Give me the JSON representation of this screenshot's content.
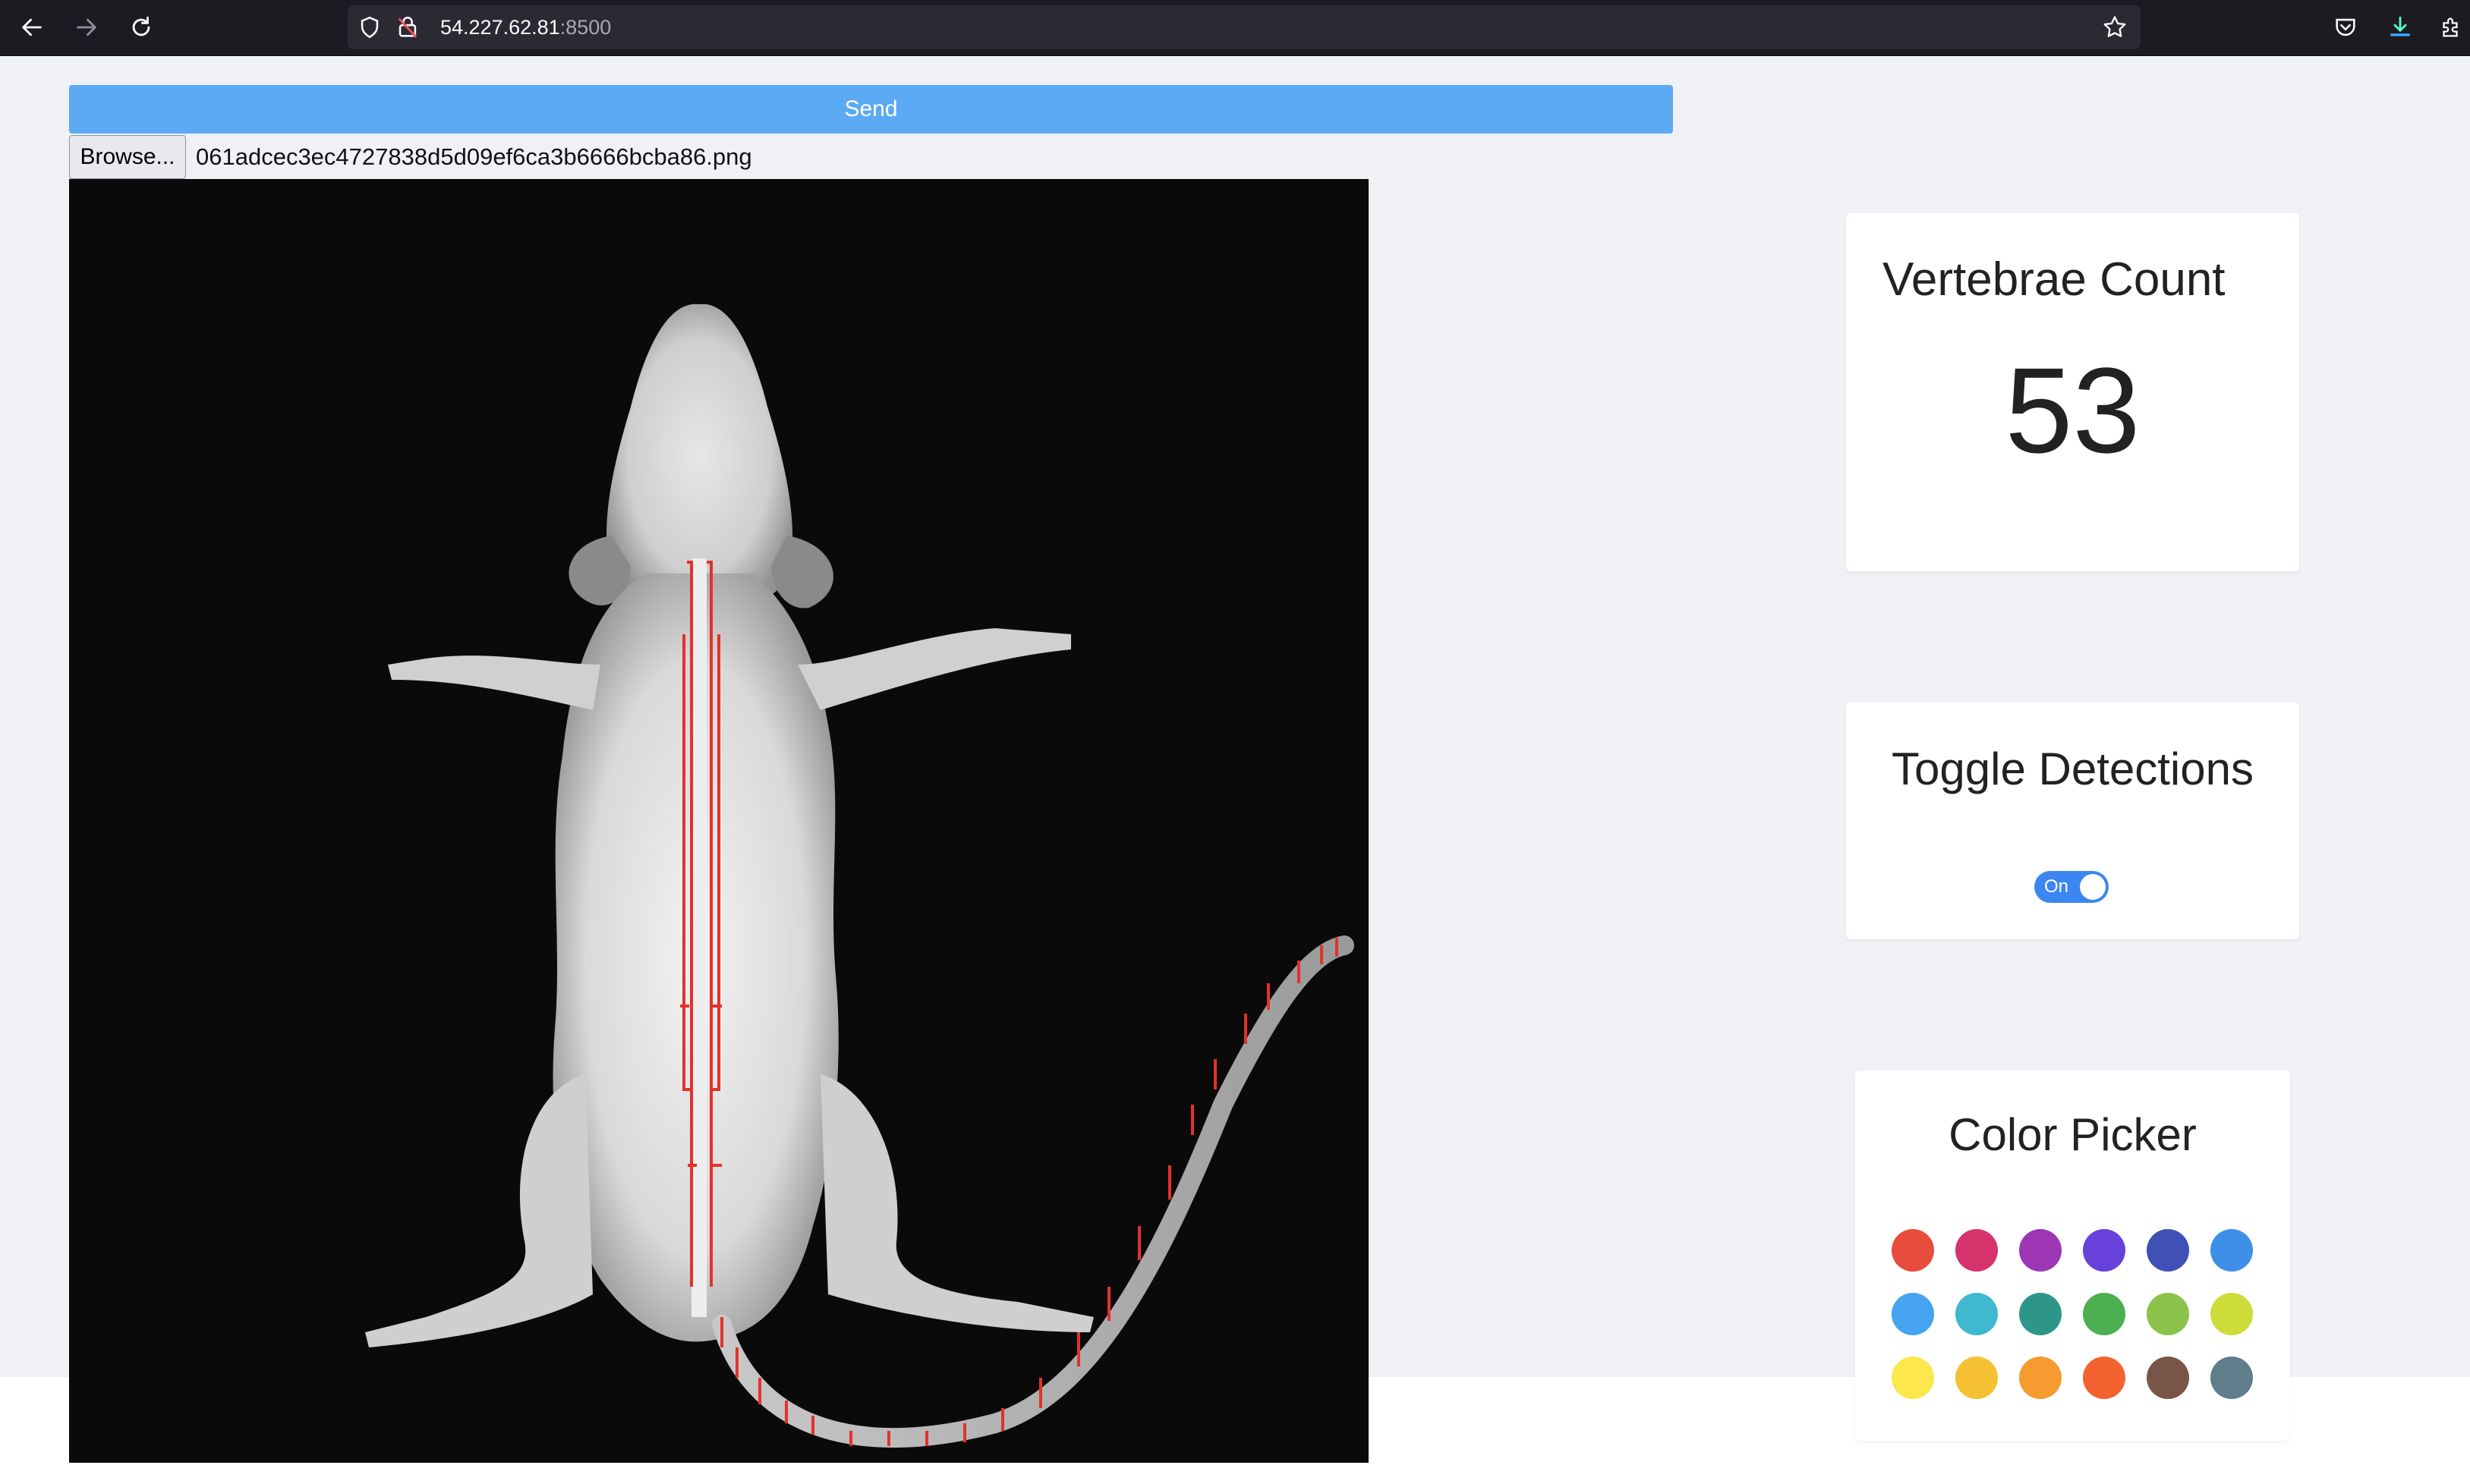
{
  "browser": {
    "url_host": "54.227.62.81",
    "url_port": ":8500",
    "icons": [
      "back-arrow-icon",
      "forward-arrow-icon",
      "reload-icon",
      "shield-icon",
      "lock-warning-icon",
      "bookmark-star-icon",
      "pocket-icon",
      "download-icon",
      "extensions-icon"
    ]
  },
  "form": {
    "send_label": "Send",
    "browse_label": "Browse...",
    "file_name": "061adcec3ec4727838d5d09ef6ca3b6666bcba86.png"
  },
  "vertebrae": {
    "title": "Vertebrae Count",
    "count": "53"
  },
  "detections": {
    "title": "Toggle Detections",
    "toggle_label": "On",
    "enabled": true
  },
  "color_picker": {
    "title": "Color Picker",
    "colors": [
      "#e74c3c",
      "#d6336c",
      "#9c36b5",
      "#6741d9",
      "#3f51b5",
      "#3d8fe8",
      "#45a3f0",
      "#3fb8d0",
      "#2e9688",
      "#4caf50",
      "#8bc34a",
      "#cddc39",
      "#fce74c",
      "#f5c132",
      "#f59b2f",
      "#f4622f",
      "#795548",
      "#607d8b"
    ]
  },
  "colors": {
    "accent": "#5ca9f4",
    "toggle": "#3b86f1",
    "detection_box": "#e3322a"
  }
}
